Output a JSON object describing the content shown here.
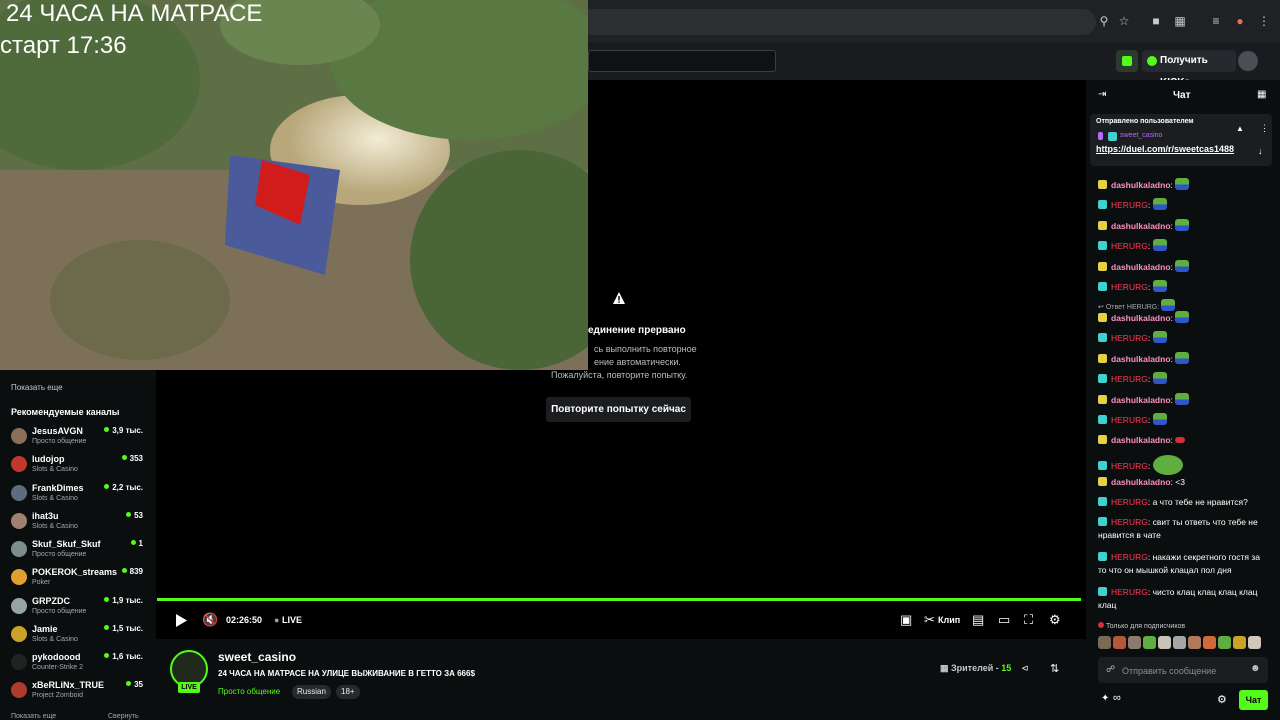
{
  "overlay": {
    "title": "24 ЧАСА НА МАТРАСЕ",
    "start": "старт 17:36"
  },
  "header": {
    "get_kicks": "Получить KICKs"
  },
  "player": {
    "error_title": "единение прервано",
    "error_line1": "сь выполнить повторное",
    "error_line2": "ение автоматически.",
    "error_line3": "Пожалуйста, повторите попытку.",
    "retry_label": "Повторите попытку сейчас",
    "time": "02:26:50",
    "live": "LIVE",
    "clip_label": "Клип",
    "progress": 1.0
  },
  "sidebar": {
    "show_more": "Показать еще",
    "recommended_title": "Рекомендуемые каналы",
    "channels": [
      {
        "name": "JesusAVGN",
        "category": "Просто общение",
        "viewers": "3,9 тыс.",
        "color": "#8a6f5a"
      },
      {
        "name": "ludojop",
        "category": "Slots & Casino",
        "viewers": "353",
        "color": "#c0392b"
      },
      {
        "name": "FrankDimes",
        "category": "Slots & Casino",
        "viewers": "2,2 тыс.",
        "color": "#5d6d7e"
      },
      {
        "name": "ihat3u",
        "category": "Slots & Casino",
        "viewers": "53",
        "color": "#a08070"
      },
      {
        "name": "Skuf_Skuf_Skuf",
        "category": "Просто общение",
        "viewers": "1",
        "color": "#7f8c8d"
      },
      {
        "name": "POKEROK_streams",
        "category": "Poker",
        "viewers": "839",
        "color": "#e0a030"
      },
      {
        "name": "GRPZDC",
        "category": "Просто общение",
        "viewers": "1,9 тыс.",
        "color": "#95a5a6"
      },
      {
        "name": "Jamie",
        "category": "Slots & Casino",
        "viewers": "1,5 тыс.",
        "color": "#c9a227"
      },
      {
        "name": "pykodoood",
        "category": "Counter-Strike 2",
        "viewers": "1,6 тыс.",
        "color": "#222222"
      },
      {
        "name": "xBeRLiNx_TRUE",
        "category": "Project Zomboid",
        "viewers": "35",
        "color": "#b03a2e"
      }
    ],
    "bottom_show_more": "Показать еще",
    "bottom_collapse": "Свернуть"
  },
  "stream": {
    "streamer": "sweet_casino",
    "live_badge": "LIVE",
    "title": "24 ЧАСА НА МАТРАСЕ НА УЛИЦЕ ВЫЖИВАНИЕ В ГЕТТО ЗА 666$",
    "category": "Просто общение",
    "tags": [
      "Russian",
      "18+"
    ],
    "viewers_label": "Зрителей - ",
    "viewers_count": "15"
  },
  "chat": {
    "title": "Чат",
    "pinned_label": "Отправлено пользователем",
    "pinned_user": "sweet_casino",
    "pinned_link": "https://duel.com/r/sweetcas1488",
    "reply_label": "Ответ HERURG:",
    "messages": [
      {
        "user": "dashulkaladno",
        "text": ""
      },
      {
        "user": "HERURG",
        "text": ""
      },
      {
        "user": "dashulkaladno",
        "text": ""
      },
      {
        "user": "HERURG",
        "text": ""
      },
      {
        "user": "dashulkaladno",
        "text": ""
      },
      {
        "user": "HERURG",
        "text": ""
      },
      {
        "user": "dashulkaladno",
        "text": ""
      },
      {
        "user": "HERURG",
        "text": ""
      },
      {
        "user": "dashulkaladno",
        "text": ""
      },
      {
        "user": "HERURG",
        "text": ""
      },
      {
        "user": "dashulkaladno",
        "text": ""
      },
      {
        "user": "HERURG",
        "text": ""
      },
      {
        "user": "dashulkaladno",
        "text": ""
      },
      {
        "user": "HERURG",
        "text": ""
      },
      {
        "user": "dashulkaladno",
        "text": "<3"
      },
      {
        "user": "HERURG",
        "text": "а что тебе не нравится?"
      },
      {
        "user": "HERURG",
        "text": "свит ты ответь что тебе не нравится в чате"
      },
      {
        "user": "HERURG",
        "text": "накажи секретного гостя за то что он мышкой клацал пол дня"
      },
      {
        "user": "HERURG",
        "text": "чисто клац клац клац клац клац"
      }
    ],
    "colon": ": ",
    "subs_only": "Только для подписчиков",
    "input_placeholder": "Отправить сообщение",
    "infinity": "∞",
    "send_label": "Чат"
  }
}
